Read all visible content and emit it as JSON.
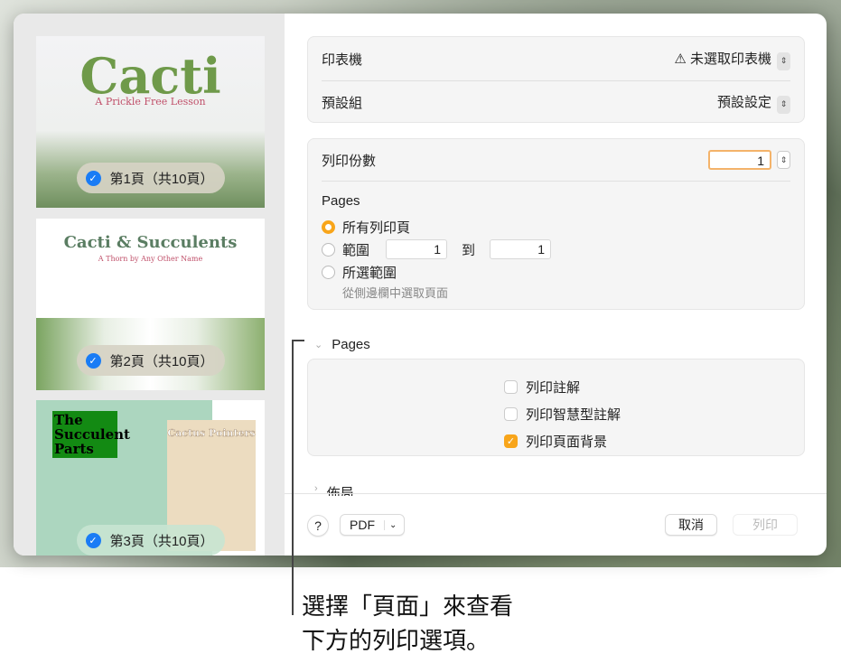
{
  "sidebar": {
    "pages": [
      {
        "title": "Cacti",
        "subtitle": "A Prickle Free Lesson",
        "badge": "第1頁（共10頁）"
      },
      {
        "title": "Cacti & Succulents",
        "subtitle": "A Thorn by Any Other Name",
        "badge": "第2頁（共10頁）"
      },
      {
        "title": "The Succulent Parts",
        "subtitle": "Cactus Pointers",
        "badge": "第3頁（共10頁）"
      }
    ]
  },
  "printer": {
    "label": "印表機",
    "value": "未選取印表機"
  },
  "presets": {
    "label": "預設組",
    "value": "預設設定"
  },
  "copies": {
    "label": "列印份數",
    "value": "1"
  },
  "pages": {
    "label": "Pages",
    "all": "所有列印頁",
    "range": "範圍",
    "from": "1",
    "to_label": "到",
    "to": "1",
    "selection": "所選範圍",
    "selection_hint": "從側邊欄中選取頁面"
  },
  "pages_section": {
    "label": "Pages",
    "options": [
      {
        "label": "列印註解",
        "checked": false
      },
      {
        "label": "列印智慧型註解",
        "checked": false
      },
      {
        "label": "列印頁面背景",
        "checked": true
      }
    ]
  },
  "layout_section": {
    "label": "佈局"
  },
  "footer": {
    "help": "?",
    "pdf": "PDF",
    "cancel": "取消",
    "print": "列印"
  },
  "callout": {
    "line1": "選擇「頁面」來查看",
    "line2": "下方的列印選項。"
  },
  "colors": {
    "accent": "#f8a51a",
    "check_blue": "#1a7cf5"
  }
}
